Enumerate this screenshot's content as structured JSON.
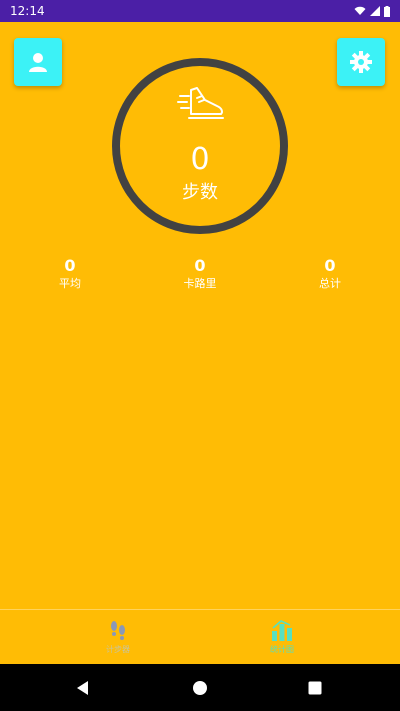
{
  "status_bar": {
    "time": "12:14",
    "background": "#4B1FA6"
  },
  "header": {
    "profile_icon": "person-icon",
    "settings_icon": "gear-icon",
    "button_color": "#3CF2F6"
  },
  "step_ring": {
    "icon": "running-shoe-icon",
    "step_count": "0",
    "label": "步数",
    "ring_color": "#424242"
  },
  "stats": [
    {
      "value": "0",
      "label": "平均"
    },
    {
      "value": "0",
      "label": "卡路里"
    },
    {
      "value": "0",
      "label": "总计"
    }
  ],
  "bottom_nav": {
    "items": [
      {
        "icon": "footprints-icon",
        "label": "计步器",
        "active": false
      },
      {
        "icon": "bar-chart-icon",
        "label": "统计图",
        "active": true
      }
    ]
  },
  "system_nav": {
    "buttons": [
      "back-icon",
      "home-icon",
      "recents-icon"
    ]
  },
  "theme": {
    "background": "#FFBC05",
    "active_nav": "#57E0C0"
  }
}
